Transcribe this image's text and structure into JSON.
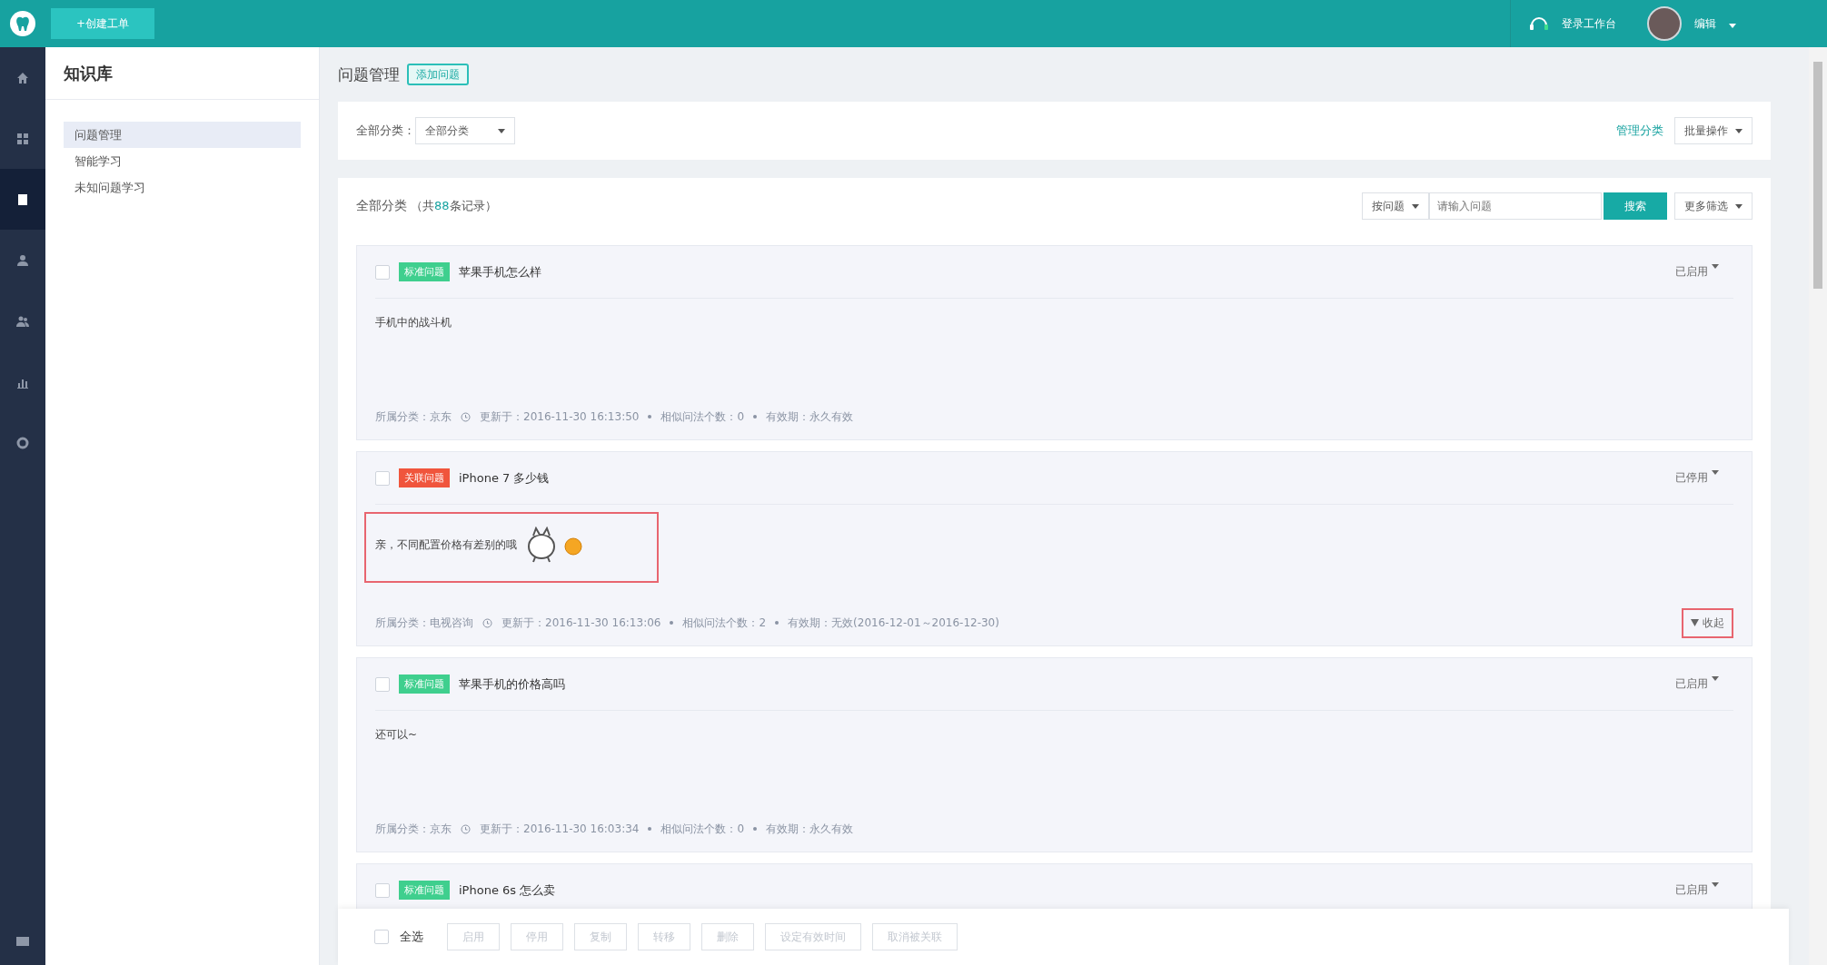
{
  "topbar": {
    "create_button": "+创建工单",
    "workbench": "登录工作台",
    "user": "编辑"
  },
  "nav": [
    {
      "selected": false
    },
    {
      "selected": false
    },
    {
      "selected": true
    },
    {
      "selected": false
    },
    {
      "selected": false
    },
    {
      "selected": false
    },
    {
      "selected": false
    }
  ],
  "sidebar": {
    "title": "知识库",
    "items": [
      {
        "label": "问题管理",
        "selected": true
      },
      {
        "label": "智能学习",
        "selected": false
      },
      {
        "label": "未知问题学习",
        "selected": false
      }
    ]
  },
  "page": {
    "title": "问题管理",
    "add_button": "添加问题"
  },
  "filter": {
    "label": "全部分类：",
    "value": "全部分类",
    "manage_link": "管理分类",
    "batch_button": "批量操作"
  },
  "list": {
    "title": "全部分类",
    "count_prefix": "（共",
    "count": "88",
    "count_suffix": "条记录）",
    "search_type": "按问题",
    "search_placeholder": "请输入问题",
    "search_button": "搜索",
    "more_button": "更多筛选"
  },
  "questions": [
    {
      "kind": "standard",
      "checked": false,
      "tag": "标准问题",
      "title": "苹果手机怎么样",
      "status": "已启用",
      "answer": "手机中的战斗机",
      "answer_highlighted": false,
      "category": "所属分类：京东",
      "updated": "更新于：2016-11-30 16:13:50",
      "similar": "相似问法个数：0",
      "validity": "有效期：永久有效"
    },
    {
      "kind": "related",
      "checked": false,
      "tag": "关联问题",
      "title": "iPhone 7 多少钱",
      "status": "已停用",
      "answer": "亲，不同配置价格有差别的哦",
      "has_stickers": true,
      "answer_highlighted": true,
      "category": "所属分类：电视咨询",
      "updated": "更新于：2016-11-30 16:13:06",
      "similar": "相似问法个数：2",
      "validity": "有效期：无效(2016-12-01～2016-12-30)",
      "collapse": "收起",
      "collapse_highlighted": true
    },
    {
      "kind": "standard",
      "checked": false,
      "tag": "标准问题",
      "title": "苹果手机的价格高吗",
      "status": "已启用",
      "answer": "还可以~",
      "answer_highlighted": false,
      "category": "所属分类：京东",
      "updated": "更新于：2016-11-30 16:03:34",
      "similar": "相似问法个数：0",
      "validity": "有效期：永久有效"
    },
    {
      "kind": "standard",
      "checked": false,
      "tag": "标准问题",
      "title": "iPhone 6s 怎么卖",
      "status": "已启用"
    }
  ],
  "bottom_bar": {
    "select_all": "全选",
    "checked": false,
    "actions": [
      {
        "label": "启用",
        "disabled": true
      },
      {
        "label": "停用",
        "disabled": true
      },
      {
        "label": "复制",
        "disabled": true
      },
      {
        "label": "转移",
        "disabled": true
      },
      {
        "label": "删除",
        "disabled": true
      },
      {
        "label": "设定有效时间",
        "disabled": true
      },
      {
        "label": "取消被关联",
        "disabled": true
      }
    ]
  }
}
